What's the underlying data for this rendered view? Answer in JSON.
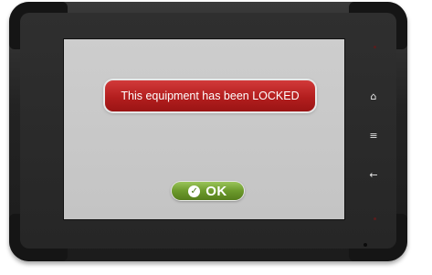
{
  "device": {
    "alert": {
      "message": "This equipment has been LOCKED",
      "color": "#b31e1e"
    },
    "ok_button": {
      "label": "OK",
      "icon": "check-circle-icon",
      "color": "#6c9a2c"
    },
    "side_keys": [
      {
        "name": "home",
        "icon": "home-icon",
        "glyph": "⌂"
      },
      {
        "name": "menu",
        "icon": "menu-icon",
        "glyph": "≡"
      },
      {
        "name": "back",
        "icon": "back-arrow-icon",
        "glyph": "←"
      }
    ],
    "screen_color": "#c8c8c8"
  }
}
